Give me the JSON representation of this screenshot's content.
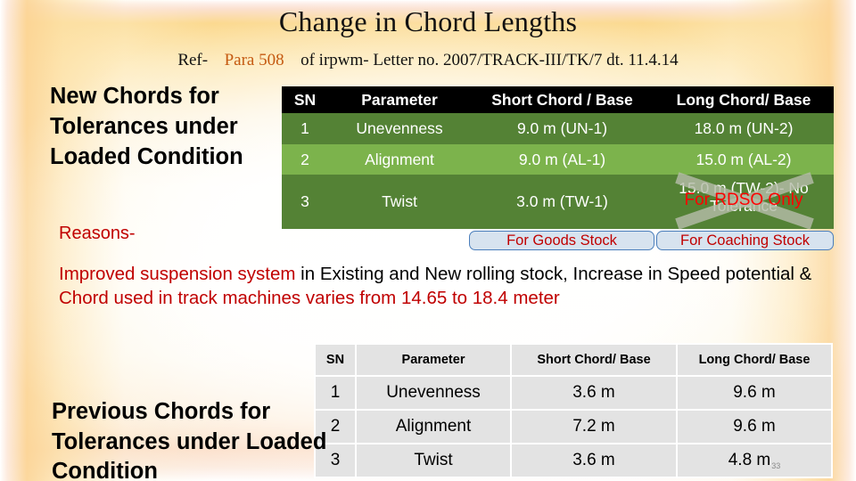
{
  "slide": {
    "title": "Change in Chord Lengths",
    "subtitle": {
      "lead": "Ref-",
      "highlight": "Para 508",
      "rest": "of irpwm- Letter no. 2007/TRACK-III/TK/7 dt. 11.4.14"
    },
    "page_number": "33"
  },
  "headings": {
    "new_chords": "New Chords for Tolerances under Loaded Condition",
    "previous_chords": "Previous  Chords for Tolerances under Loaded Condition",
    "reasons_label": "Reasons-"
  },
  "reasons": {
    "part1_red": "Improved suspension system",
    "part2_black": " in Existing and New rolling stock, Increase in Speed potential & ",
    "part3_red": "Chord used in track machines varies from 14.65 to 18.4 meter"
  },
  "table_new": {
    "headers": [
      "SN",
      "Parameter",
      "Short Chord / Base",
      "Long Chord/ Base"
    ],
    "rows": [
      {
        "sn": "1",
        "parameter": "Unevenness",
        "short": "9.0 m (UN-1)",
        "long": "18.0 m (UN-2)"
      },
      {
        "sn": "2",
        "parameter": "Alignment",
        "short": "9.0 m (AL-1)",
        "long": "15.0 m (AL-2)"
      },
      {
        "sn": "3",
        "parameter": "Twist",
        "short": "3.0 m (TW-1)",
        "long_struck": "15.0 m (TW-2)- No Tolerance",
        "overlay": "For RDSO Only"
      }
    ]
  },
  "stock_buttons": {
    "goods": "For Goods Stock",
    "coaching": "For Coaching Stock"
  },
  "table_prev": {
    "headers": [
      "SN",
      "Parameter",
      "Short Chord/ Base",
      "Long Chord/ Base"
    ],
    "rows": [
      {
        "sn": "1",
        "parameter": "Unevenness",
        "short": "3.6 m",
        "long": "9.6 m"
      },
      {
        "sn": "2",
        "parameter": "Alignment",
        "short": "7.2 m",
        "long": "9.6 m"
      },
      {
        "sn": "3",
        "parameter": "Twist",
        "short": "3.6 m",
        "long": "4.8 m"
      }
    ]
  },
  "colors": {
    "header_black": "#000000",
    "row_dark_green": "#548235",
    "row_light_green": "#7cb34c",
    "accent_red": "#c00000",
    "overlay_red": "#ff0000",
    "subtitle_highlight": "#c55a11",
    "grey_cell": "#e3e3e3",
    "button_border_blue": "#4a7ebb"
  }
}
